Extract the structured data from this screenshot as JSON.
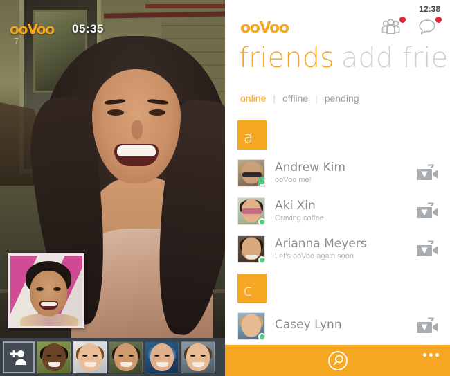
{
  "call": {
    "logo": "ooVoo",
    "participant_number": "7",
    "timer": "05:35",
    "add_participant_icon": "add-person-icon",
    "participants": [
      {
        "name": "participant-1"
      },
      {
        "name": "participant-2"
      },
      {
        "name": "participant-3"
      },
      {
        "name": "participant-4"
      },
      {
        "name": "participant-5"
      }
    ],
    "self_view_label": "self-view"
  },
  "list": {
    "time": "12:38",
    "brand": "ooVoo",
    "header_icons": [
      {
        "icon": "group-people-icon",
        "badge": true
      },
      {
        "icon": "chat-bubble-icon",
        "badge": true
      }
    ],
    "title_active": "friends",
    "title_inactive": "add frien",
    "tabs": [
      {
        "label": "online",
        "selected": true
      },
      {
        "label": "offline",
        "selected": false
      },
      {
        "label": "pending",
        "selected": false
      }
    ],
    "tab_separator": "|",
    "groups": [
      {
        "letter": "a",
        "friends": [
          {
            "name": "Andrew Kim",
            "status": "ooVoo me!",
            "presence": "mobile",
            "action_icon": "video-call-icon"
          },
          {
            "name": "Aki Xin",
            "status": "Craving coffee",
            "presence": "online",
            "action_icon": "video-call-icon"
          },
          {
            "name": "Arianna Meyers",
            "status": "Let's ooVoo again soon",
            "presence": "online",
            "action_icon": "video-call-icon"
          }
        ]
      },
      {
        "letter": "c",
        "friends": [
          {
            "name": "Casey Lynn",
            "status": "",
            "presence": "online",
            "action_icon": "video-call-icon"
          }
        ]
      }
    ],
    "appbar": {
      "search_icon": "search-icon",
      "more_icon": "ellipsis-more-icon"
    }
  },
  "colors": {
    "accent_orange": "#f5a623",
    "badge_red": "#e0243c",
    "presence_green": "#4ad07d",
    "text_gray": "#8b8b8b",
    "filmstrip_bg": "#3c4249"
  }
}
